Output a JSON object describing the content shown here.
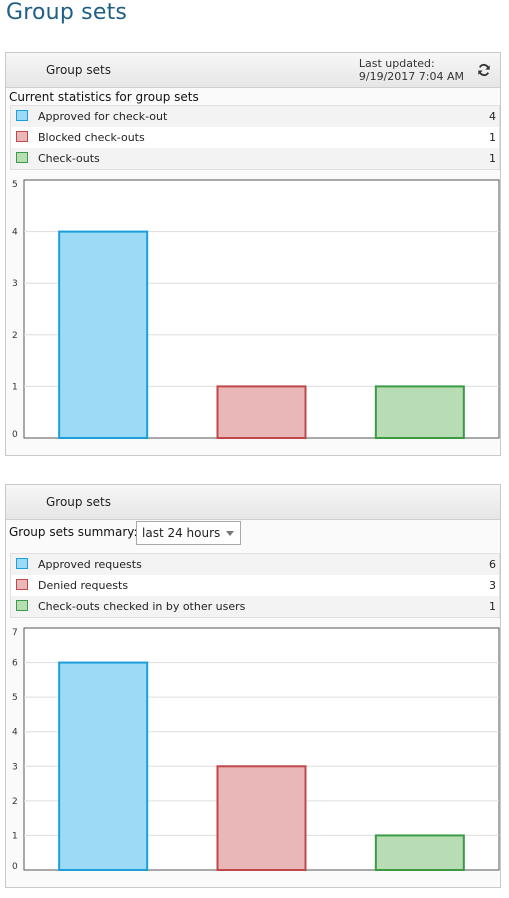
{
  "page": {
    "title": "Group sets"
  },
  "panel1": {
    "header_title": "Group sets",
    "last_updated_label": "Last updated:",
    "last_updated_value": "9/19/2017 7:04 AM",
    "refresh_icon": "refresh-icon",
    "section_label": "Current statistics for group sets",
    "legend": [
      {
        "label": "Approved for check-out",
        "count": "4",
        "color": "#9cdaf6",
        "border": "#1a9fd9"
      },
      {
        "label": "Blocked check-outs",
        "count": "1",
        "color": "#e9b7b7",
        "border": "#c0474a"
      },
      {
        "label": "Check-outs",
        "count": "1",
        "color": "#b8ddb4",
        "border": "#3c9a45"
      }
    ]
  },
  "panel2": {
    "header_title": "Group sets",
    "summary_label": "Group sets summary:",
    "summary_select": "last 24 hours",
    "legend": [
      {
        "label": "Approved requests",
        "count": "6",
        "color": "#9cdaf6",
        "border": "#1a9fd9"
      },
      {
        "label": "Denied requests",
        "count": "3",
        "color": "#e9b7b7",
        "border": "#c0474a"
      },
      {
        "label": "Check-outs checked in by other users",
        "count": "1",
        "color": "#b8ddb4",
        "border": "#3c9a45"
      }
    ]
  },
  "chart_data": [
    {
      "type": "bar",
      "categories": [
        "Approved for check-out",
        "Blocked check-outs",
        "Check-outs"
      ],
      "values": [
        4,
        1,
        1
      ],
      "colors": [
        "#9cdaf6",
        "#e9b7b7",
        "#b8ddb4"
      ],
      "borders": [
        "#1a9fd9",
        "#c0474a",
        "#3c9a45"
      ],
      "yticks": [
        "0",
        "1",
        "2",
        "3",
        "4",
        "5"
      ],
      "ylim": [
        0,
        5
      ],
      "grid": true
    },
    {
      "type": "bar",
      "categories": [
        "Approved requests",
        "Denied requests",
        "Check-outs checked in by other users"
      ],
      "values": [
        6,
        3,
        1
      ],
      "colors": [
        "#9cdaf6",
        "#e9b7b7",
        "#b8ddb4"
      ],
      "borders": [
        "#1a9fd9",
        "#c0474a",
        "#3c9a45"
      ],
      "yticks": [
        "0",
        "1",
        "2",
        "3",
        "4",
        "5",
        "6",
        "7"
      ],
      "ylim": [
        0,
        7
      ],
      "grid": true
    }
  ]
}
